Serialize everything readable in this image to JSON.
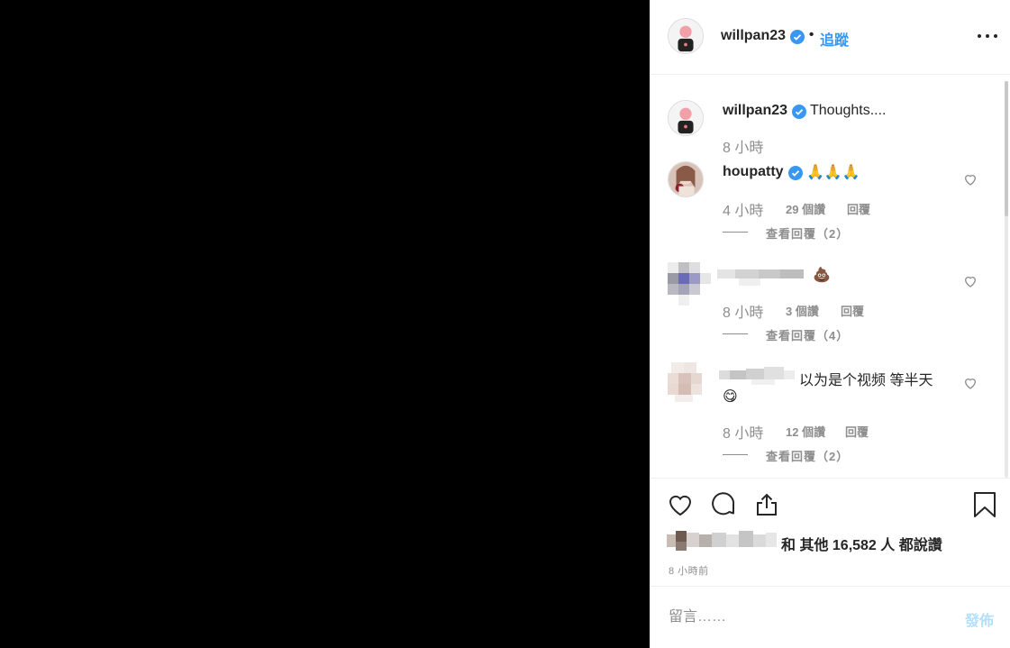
{
  "header": {
    "username": "willpan23",
    "separator": "•",
    "follow_label": "追蹤"
  },
  "caption": {
    "username": "willpan23",
    "text": "Thoughts....",
    "time": "8 小時"
  },
  "comments": [
    {
      "username": "houpatty",
      "text": "🙏🙏🙏",
      "time": "4 小時",
      "likes": "29 個讚",
      "reply_label": "回覆",
      "view_replies": "查看回覆（2）"
    },
    {
      "text": "💩",
      "time": "8 小時",
      "likes": "3 個讚",
      "reply_label": "回覆",
      "view_replies": "查看回覆（4）"
    },
    {
      "text_line1": "以为是个视频 等半天",
      "text_line2": "😋",
      "time": "8 小時",
      "likes": "12 個讚",
      "reply_label": "回覆",
      "view_replies": "查看回覆（2）"
    }
  ],
  "likes_text": "和 其他 16,582 人 都說讚",
  "post_date": "8 小時前",
  "composer": {
    "placeholder": "留言……",
    "post_label": "發佈"
  },
  "colors": {
    "accent": "#3897f0",
    "verified": "#3897f0",
    "muted": "#8e8e8e",
    "post_disabled": "#b2dffc"
  },
  "icons": [
    "verified-icon",
    "more-options-icon",
    "heart-icon",
    "comment-icon",
    "share-icon",
    "bookmark-icon"
  ]
}
